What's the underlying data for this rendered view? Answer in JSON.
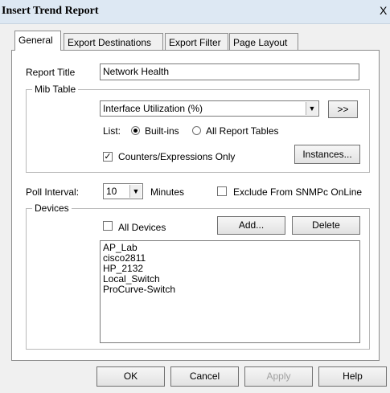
{
  "window": {
    "title": "Insert Trend Report",
    "close_glyph": "X"
  },
  "tabs": [
    "General",
    "Export Destinations",
    "Export Filter",
    "Page Layout"
  ],
  "report_title": {
    "label": "Report Title",
    "value": "Network Health"
  },
  "mib_table": {
    "group_label": "Mib Table",
    "selected": "Interface Utilization (%)",
    "more_button": ">>",
    "list_label": "List:",
    "options": [
      "Built-ins",
      "All Report Tables"
    ],
    "counters_label": "Counters/Expressions Only",
    "instances_button": "Instances..."
  },
  "poll": {
    "label": "Poll Interval:",
    "value": "10",
    "unit": "Minutes",
    "exclude_label": "Exclude From SNMPc OnLine"
  },
  "devices": {
    "group_label": "Devices",
    "all_devices_label": "All Devices",
    "add_button": "Add...",
    "delete_button": "Delete",
    "items": [
      "AP_Lab",
      "cisco2811",
      "HP_2132",
      "Local_Switch",
      "ProCurve-Switch"
    ]
  },
  "buttons": {
    "ok": "OK",
    "cancel": "Cancel",
    "apply": "Apply",
    "help": "Help"
  }
}
